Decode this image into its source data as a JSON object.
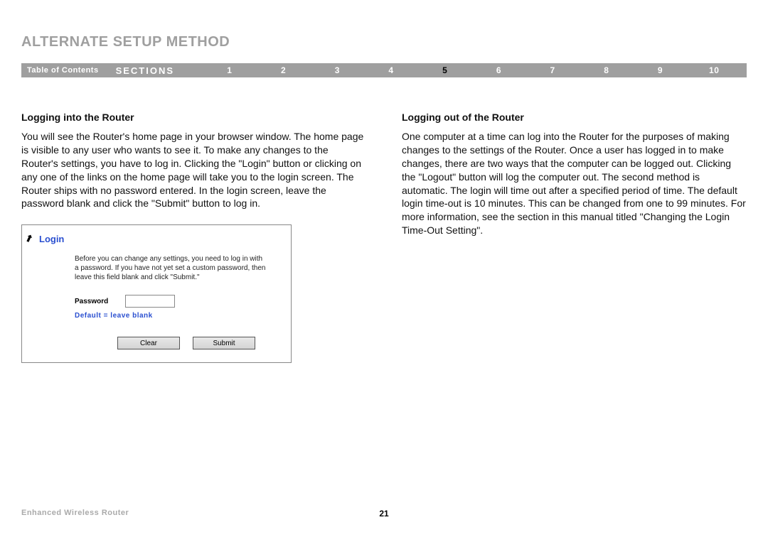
{
  "title": "ALTERNATE SETUP METHOD",
  "nav": {
    "toc": "Table of Contents",
    "sections": "SECTIONS",
    "items": [
      "1",
      "2",
      "3",
      "4",
      "5",
      "6",
      "7",
      "8",
      "9",
      "10"
    ],
    "current": "5"
  },
  "left": {
    "heading": "Logging into the Router",
    "body": "You will see the Router's home page in your browser window. The home page is visible to any user who wants to see it. To make any changes to the Router's settings, you have to log in. Clicking the \"Login\" button or clicking on any one of the links on the home page will take you to the login screen. The Router ships with no password entered. In the login screen, leave the password blank and click the \"Submit\" button to log in."
  },
  "right": {
    "heading": "Logging out of the Router",
    "body": "One computer at a time can log into the Router for the purposes of making changes to the settings of the Router. Once a user has logged in to make changes, there are two ways that the computer can be logged out. Clicking the \"Logout\" button will log the computer out. The second method is automatic. The login will time out after a specified period of time. The default login time-out is 10 minutes. This can be changed from one to 99 minutes. For more information, see the section in this manual titled \"Changing the Login Time-Out Setting\"."
  },
  "login_card": {
    "title": "Login",
    "desc": "Before you can change any settings, you need to log in with a password. If you have not yet set a custom password, then leave this field blank and click \"Submit.\"",
    "password_label": "Password",
    "hint": "Default = leave blank",
    "clear": "Clear",
    "submit": "Submit"
  },
  "footer": {
    "left": "Enhanced Wireless Router",
    "page": "21"
  }
}
